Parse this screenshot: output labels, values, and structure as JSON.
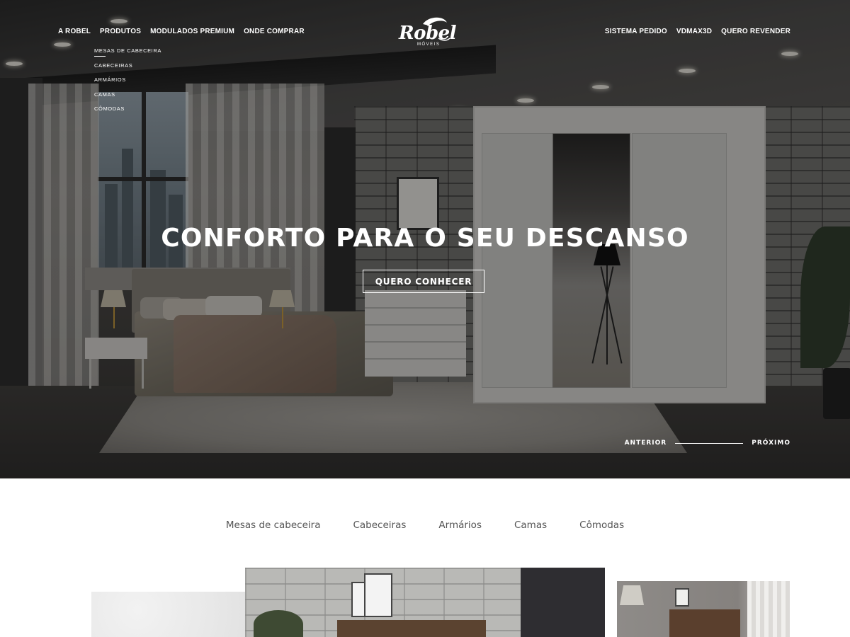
{
  "nav": {
    "left": [
      "A ROBEL",
      "PRODUTOS",
      "MODULADOS PREMIUM",
      "ONDE COMPRAR"
    ],
    "right": [
      "SISTEMA PEDIDO",
      "VDMAX3D",
      "QUERO REVENDER"
    ],
    "submenu": [
      "MESAS DE CABECEIRA",
      "CABECEIRAS",
      "ARMÁRIOS",
      "CAMAS",
      "CÔMODAS"
    ]
  },
  "logo": {
    "word": "Robel",
    "sub": "MÓVEIS"
  },
  "hero": {
    "title": "CONFORTO PARA O SEU DESCANSO",
    "cta": "QUERO CONHECER",
    "prev": "ANTERIOR",
    "next": "PRÓXIMO"
  },
  "categories": [
    "Mesas de cabeceira",
    "Cabeceiras",
    "Armários",
    "Camas",
    "Cômodas"
  ],
  "colors": {
    "overlay": "#000000",
    "text_on_hero": "#ffffff",
    "tab_text": "#555555"
  },
  "icons": {
    "logo": "robel-logo-icon",
    "slider_divider": "line-divider-icon"
  }
}
